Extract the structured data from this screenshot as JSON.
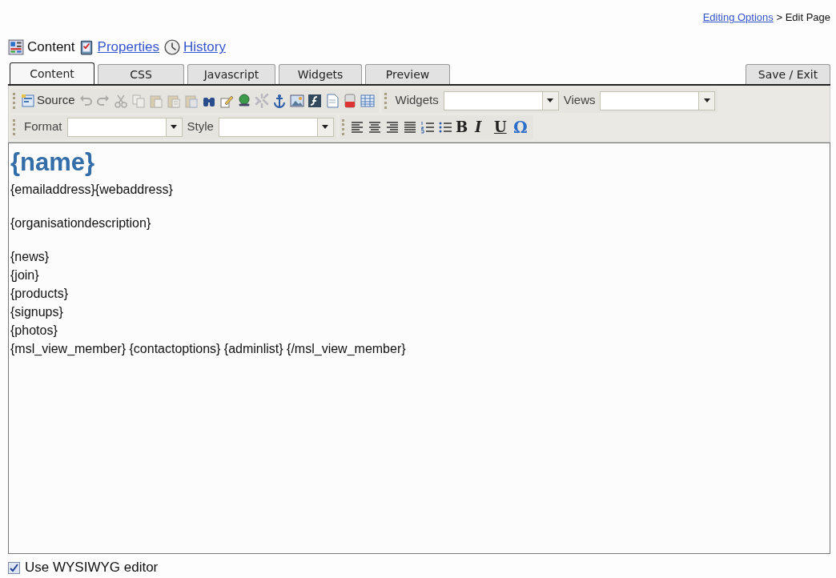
{
  "breadcrumb": {
    "link": "Editing Options",
    "separator": ">",
    "current": "Edit Page"
  },
  "page_nav": [
    {
      "label": "Content",
      "link": false
    },
    {
      "label": "Properties",
      "link": true
    },
    {
      "label": "History",
      "link": true
    }
  ],
  "tabs": [
    {
      "label": "Content",
      "selected": true
    },
    {
      "label": "CSS",
      "selected": false
    },
    {
      "label": "Javascript",
      "selected": false
    },
    {
      "label": "Widgets",
      "selected": false
    },
    {
      "label": "Preview",
      "selected": false
    }
  ],
  "save_button": "Save / Exit",
  "toolbar_row_1": {
    "buttons": [
      {
        "label": "Source",
        "disabled": false
      },
      {
        "disabled": true
      },
      {
        "disabled": true
      },
      {
        "disabled": true
      },
      {
        "disabled": true
      },
      {
        "disabled": true
      },
      {
        "disabled": true
      },
      {
        "disabled": true
      },
      {
        "disabled": false
      },
      {
        "disabled": false
      },
      {
        "disabled": false
      },
      {
        "disabled": true
      },
      {
        "disabled": false
      },
      {
        "disabled": false
      },
      {
        "disabled": false
      },
      {
        "disabled": false
      },
      {
        "disabled": false
      },
      {
        "disabled": false
      }
    ],
    "dropdowns": [
      {
        "label": "Widgets"
      },
      {
        "label": "Views"
      }
    ]
  },
  "toolbar_row_2": {
    "dropdowns": [
      {
        "label": "Format"
      },
      {
        "label": "Style"
      }
    ],
    "buttons": [
      {
        "disabled": false
      },
      {
        "disabled": false
      },
      {
        "disabled": false
      },
      {
        "disabled": false
      },
      {
        "disabled": false
      },
      {
        "disabled": false
      },
      {
        "label": "B",
        "disabled": false
      },
      {
        "label": "I",
        "disabled": false
      },
      {
        "label": "U",
        "disabled": false
      },
      {
        "label": "Ω",
        "disabled": false
      }
    ]
  },
  "editor": {
    "heading": "{name}",
    "paragraphs": [
      [
        "{emailaddress}{webaddress}"
      ],
      [
        "{organisationdescription}"
      ],
      [
        "{news}",
        "{join}",
        "{products}",
        "{signups}",
        "{photos}",
        "{msl_view_member} {contactoptions} {adminlist} {/msl_view_member}"
      ]
    ]
  },
  "wysiwyg": {
    "label": "Use WYSIWYG editor",
    "checked": true
  }
}
